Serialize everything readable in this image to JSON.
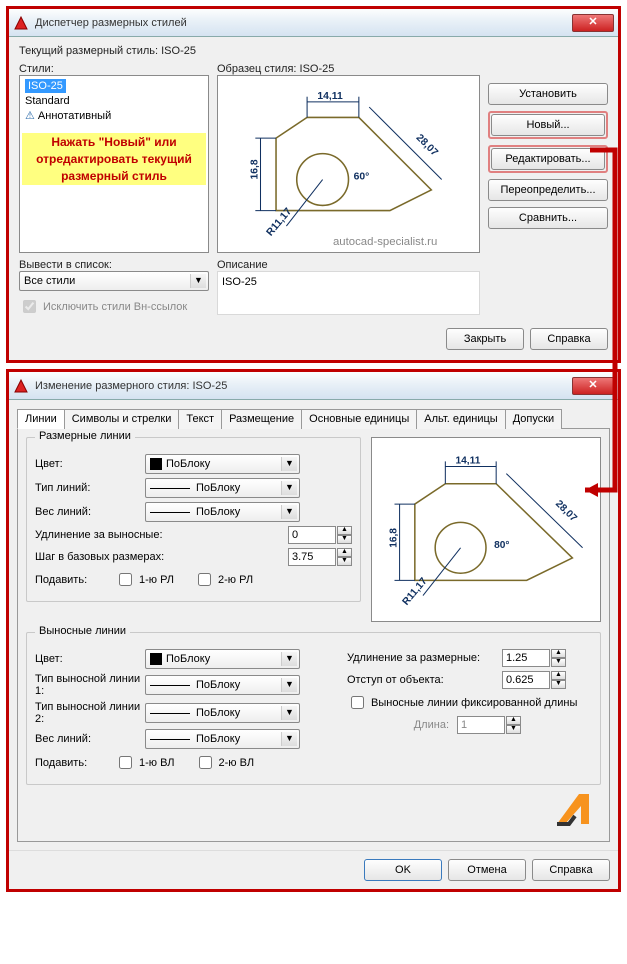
{
  "dlg1": {
    "title": "Диспетчер размерных стилей",
    "current_label": "Текущий размерный стиль: ISO-25",
    "styles_label": "Стили:",
    "styles": {
      "s1": "ISO-25",
      "s2": "Standard",
      "s3": "Аннотативный"
    },
    "hint": "Нажать \"Новый\" или отредактировать текущий размерный стиль",
    "filter_label": "Вывести в список:",
    "filter_value": "Все стили",
    "xref_chk": "Исключить стили Вн-ссылок",
    "preview_label": "Образец стиля: ISO-25",
    "desc_label": "Описание",
    "desc_value": "ISO-25",
    "btn_set": "Установить",
    "btn_new": "Новый...",
    "btn_edit": "Редактировать...",
    "btn_override": "Переопределить...",
    "btn_compare": "Сравнить...",
    "btn_close": "Закрыть",
    "btn_help": "Справка",
    "watermark": "autocad-specialist.ru"
  },
  "dlg2": {
    "title": "Изменение размерного стиля: ISO-25",
    "tabs": {
      "t1": "Линии",
      "t2": "Символы и стрелки",
      "t3": "Текст",
      "t4": "Размещение",
      "t5": "Основные единицы",
      "t6": "Альт. единицы",
      "t7": "Допуски"
    },
    "dimlines": {
      "group": "Размерные линии",
      "color": "Цвет:",
      "color_v": "ПоБлоку",
      "ltype": "Тип линий:",
      "ltype_v": "ПоБлоку",
      "lweight": "Вес линий:",
      "lweight_v": "ПоБлоку",
      "extend": "Удлинение за выносные:",
      "extend_v": "0",
      "baseline": "Шаг в базовых размерах:",
      "baseline_v": "3.75",
      "suppress": "Подавить:",
      "sup1": "1-ю РЛ",
      "sup2": "2-ю РЛ"
    },
    "extlines": {
      "group": "Выносные линии",
      "color": "Цвет:",
      "color_v": "ПоБлоку",
      "lt1": "Тип выносной линии 1:",
      "lt1_v": "ПоБлоку",
      "lt2": "Тип выносной линии 2:",
      "lt2_v": "ПоБлоку",
      "lweight": "Вес линий:",
      "lweight_v": "ПоБлоку",
      "suppress": "Подавить:",
      "sup1": "1-ю ВЛ",
      "sup2": "2-ю ВЛ",
      "ext_beyond": "Удлинение за размерные:",
      "ext_beyond_v": "1.25",
      "offset": "Отступ от объекта:",
      "offset_v": "0.625",
      "fixed": "Выносные линии фиксированной длины",
      "length": "Длина:",
      "length_v": "1"
    },
    "btn_ok": "OK",
    "btn_cancel": "Отмена",
    "btn_help": "Справка"
  },
  "preview_dims": {
    "d1": "14,11",
    "d2": "16,8",
    "d3": "28,07",
    "d4": "60°",
    "d4b": "80°",
    "d5": "R11,17"
  }
}
